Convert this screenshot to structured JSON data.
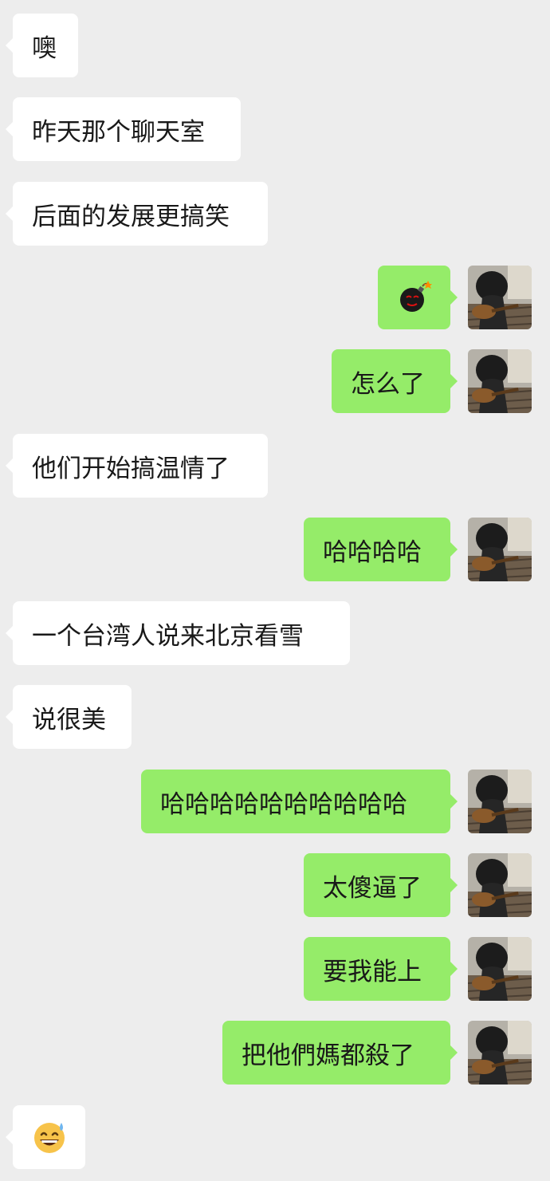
{
  "conversation": {
    "messages": [
      {
        "side": "in",
        "text": "噢"
      },
      {
        "side": "in",
        "text": "昨天那个聊天室"
      },
      {
        "side": "in",
        "text": "后面的发展更搞笑"
      },
      {
        "side": "out",
        "icon": "bomb-emoji-icon"
      },
      {
        "side": "out",
        "text": "怎么了"
      },
      {
        "side": "in",
        "text": "他们开始搞温情了"
      },
      {
        "side": "out",
        "text": "哈哈哈哈"
      },
      {
        "side": "in",
        "text": "一个台湾人说来北京看雪"
      },
      {
        "side": "in",
        "text": "说很美"
      },
      {
        "side": "out",
        "text": "哈哈哈哈哈哈哈哈哈哈"
      },
      {
        "side": "out",
        "text": "太傻逼了"
      },
      {
        "side": "out",
        "text": "要我能上"
      },
      {
        "side": "out",
        "text": "把他們媽都殺了"
      },
      {
        "side": "in",
        "icon": "grinning-sweat-emoji-icon"
      }
    ]
  },
  "colors": {
    "background": "#ededed",
    "incoming_bubble": "#ffffff",
    "outgoing_bubble": "#95ec69",
    "text": "#191919"
  }
}
